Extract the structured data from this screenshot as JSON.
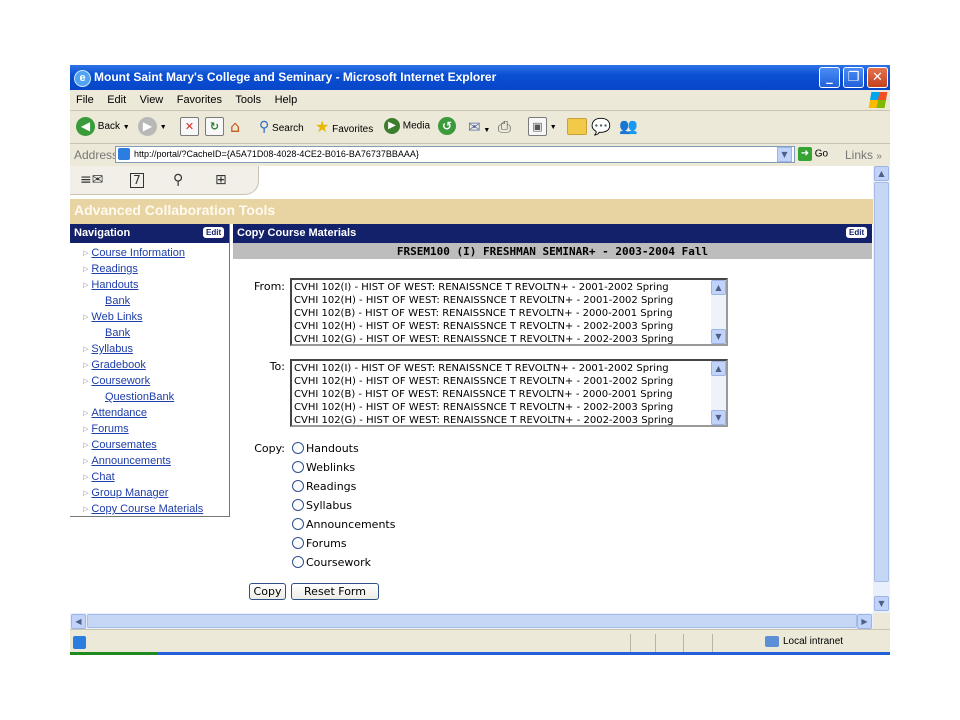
{
  "window": {
    "title": "Mount Saint Mary's College and Seminary - Microsoft Internet Explorer",
    "ie_icon": "ie-logo-icon"
  },
  "menubar": {
    "items": [
      "File",
      "Edit",
      "View",
      "Favorites",
      "Tools",
      "Help"
    ]
  },
  "toolbar": {
    "back": "Back",
    "search": "Search",
    "favorites": "Favorites",
    "media": "Media"
  },
  "address": {
    "label": "Address",
    "url": "http://portal/?CacheID={A5A71D08-4028-4CE2-B016-BA76737BBAAA}",
    "go": "Go",
    "links": "Links"
  },
  "page": {
    "section_title": "Advanced Collaboration Tools",
    "nav_title": "Navigation",
    "edit_label": "Edit",
    "nav_items": [
      {
        "label": "Course Information"
      },
      {
        "label": "Readings"
      },
      {
        "label": "Handouts",
        "sub": "Bank"
      },
      {
        "label": "Web Links",
        "sub": "Bank"
      },
      {
        "label": "Syllabus"
      },
      {
        "label": "Gradebook"
      },
      {
        "label": "Coursework",
        "sub": "QuestionBank"
      },
      {
        "label": "Attendance"
      },
      {
        "label": "Forums"
      },
      {
        "label": "Coursemates"
      },
      {
        "label": "Announcements"
      },
      {
        "label": "Chat"
      },
      {
        "label": "Group Manager"
      },
      {
        "label": "Copy Course Materials"
      }
    ],
    "main_title": "Copy Course Materials",
    "course_title": "FRSEM100 (I) FRESHMAN SEMINAR+ - 2003-2004 Fall",
    "from_label": "From:",
    "to_label": "To:",
    "copy_label": "Copy:",
    "course_options": [
      "CVHI 102(I) - HIST OF WEST: RENAISSNCE T REVOLTN+ - 2001-2002 Spring",
      "CVHI 102(H) - HIST OF WEST: RENAISSNCE T REVOLTN+ - 2001-2002 Spring",
      "CVHI 102(B) - HIST OF WEST: RENAISSNCE T REVOLTN+ - 2000-2001 Spring",
      "CVHI 102(H) - HIST OF WEST: RENAISSNCE T REVOLTN+ - 2002-2003 Spring",
      "CVHI 102(G) - HIST OF WEST: RENAISSNCE T REVOLTN+ - 2002-2003 Spring"
    ],
    "copy_options": [
      "Handouts",
      "Weblinks",
      "Readings",
      "Syllabus",
      "Announcements",
      "Forums",
      "Coursework"
    ],
    "copy_button": "Copy",
    "reset_button": "Reset Form"
  },
  "status": {
    "zone": "Local intranet"
  },
  "colors": {
    "titlebar": "#0a4fd3",
    "header_bg": "#13216b",
    "section_bar": "#e8d4a2",
    "link": "#1e3ea8"
  }
}
